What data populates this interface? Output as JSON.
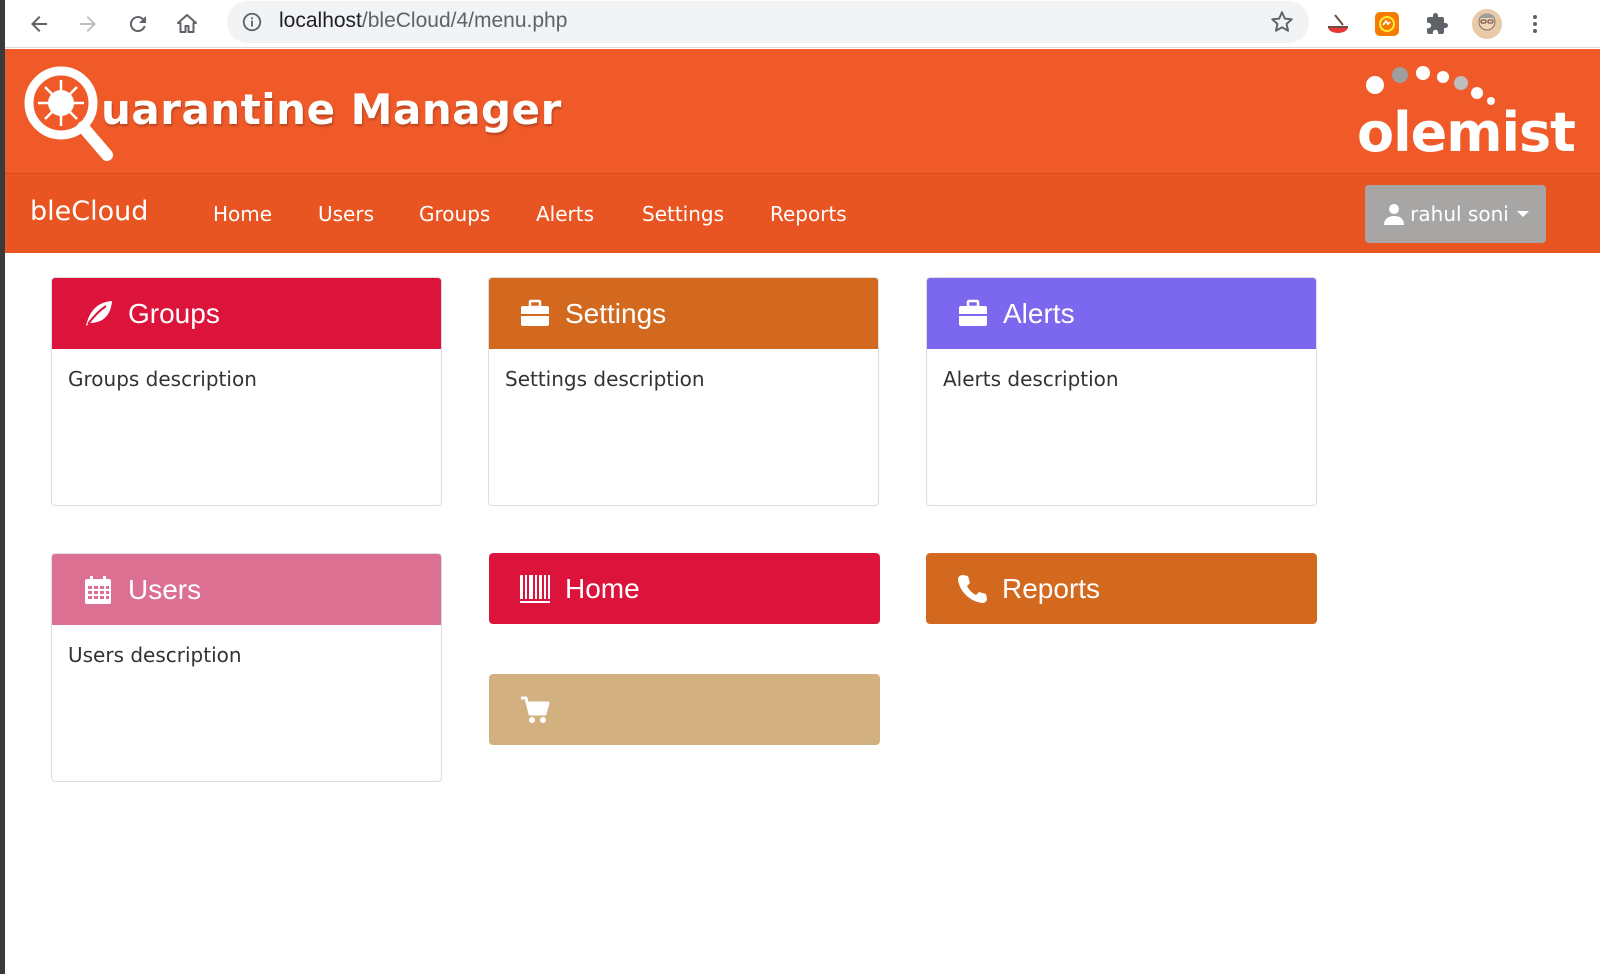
{
  "browser": {
    "url_host": "localhost",
    "url_path": "/bleCloud/4/menu.php"
  },
  "header": {
    "app_name": "uarantine Manager",
    "brand": "olemist"
  },
  "navbar": {
    "brand": "bleCloud",
    "links": [
      "Home",
      "Users",
      "Groups",
      "Alerts",
      "Settings",
      "Reports"
    ],
    "user": "rahul soni"
  },
  "tiles": [
    {
      "title": "Groups",
      "description": "Groups description",
      "color": "#dc143c",
      "icon": "leaf-icon"
    },
    {
      "title": "Settings",
      "description": "Settings description",
      "color": "#d2691e",
      "icon": "briefcase-icon"
    },
    {
      "title": "Alerts",
      "description": "Alerts description",
      "color": "#7b68ee",
      "icon": "briefcase-icon"
    },
    {
      "title": "Users",
      "description": "Users description",
      "color": "#db7093",
      "icon": "calendar-icon"
    },
    {
      "title": "Home",
      "description": "",
      "color": "#dc143c",
      "icon": "barcode-icon"
    },
    {
      "title": "Reports",
      "description": "",
      "color": "#d2691e",
      "icon": "phone-icon"
    },
    {
      "title": "",
      "description": "",
      "color": "#d2b07f",
      "icon": "cart-icon"
    }
  ],
  "colors": {
    "header_bg": "#f05a28",
    "navbar_bg": "#e95522",
    "user_button": "#a7a6a5"
  }
}
